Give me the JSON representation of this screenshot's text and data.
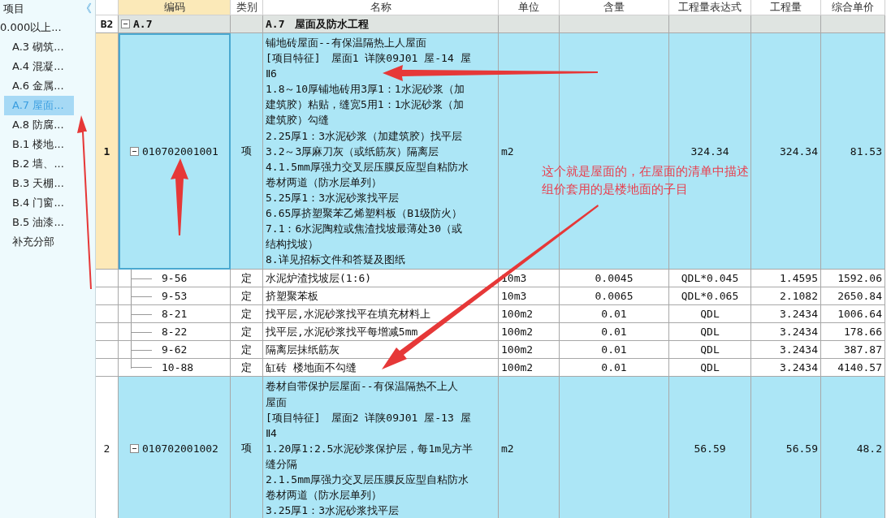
{
  "sidebar": {
    "title": "项目",
    "collapse_icon": "《",
    "items": [
      {
        "label": "0.000以上...",
        "selected": false
      },
      {
        "label": "A.3 砌筑...",
        "selected": false
      },
      {
        "label": "A.4 混凝...",
        "selected": false
      },
      {
        "label": "A.6 金属...",
        "selected": false
      },
      {
        "label": "A.7 屋面...",
        "selected": true
      },
      {
        "label": "A.8 防腐...",
        "selected": false
      },
      {
        "label": "B.1 楼地...",
        "selected": false
      },
      {
        "label": "B.2 墙、...",
        "selected": false
      },
      {
        "label": "B.3 天棚...",
        "selected": false
      },
      {
        "label": "B.4 门窗...",
        "selected": false
      },
      {
        "label": "B.5 油漆...",
        "selected": false
      },
      {
        "label": "补充分部",
        "selected": false
      }
    ]
  },
  "table": {
    "columns": [
      {
        "label": "编码",
        "selected": true
      },
      {
        "label": "类别",
        "selected": false
      },
      {
        "label": "名称",
        "selected": false
      },
      {
        "label": "单位",
        "selected": false
      },
      {
        "label": "含量",
        "selected": false
      },
      {
        "label": "工程量表达式",
        "selected": false
      },
      {
        "label": "工程量",
        "selected": false
      },
      {
        "label": "综合单价",
        "selected": false
      }
    ],
    "rows": [
      {
        "kind": "section",
        "row_header": "B2",
        "code": "A.7",
        "name": "A.7　屋面及防水工程",
        "expanded": true
      },
      {
        "kind": "item",
        "row_header": "1",
        "code": "010702001001",
        "type": "项",
        "name_lines": [
          "铺地砖屋面--有保温隔热上人屋面",
          "[项目特征]　屋面1 详陕09J01 屋-14 屋",
          "Ⅱ6",
          "1.8～10厚铺地砖用3厚1：1水泥砂浆（加",
          "建筑胶）粘贴，缝宽5用1：1水泥砂浆（加",
          "建筑胶）勾缝",
          "2.25厚1：3水泥砂浆（加建筑胶）找平层",
          "3.2～3厚麻刀灰（或纸筋灰）隔离层",
          "4.1.5mm厚强力交叉层压膜反应型自粘防水",
          "卷材两道（防水层单列）",
          "5.25厚1：3水泥砂浆找平层",
          "6.65厚挤塑聚苯乙烯塑料板（B1级防火）",
          "7.1：6水泥陶粒或焦渣找坡最薄处30（或",
          "结构找坡）",
          "8.详见招标文件和答疑及图纸"
        ],
        "unit": "m2",
        "expression": "324.34",
        "quantity": "324.34",
        "unit_price": "81.53",
        "expanded": true,
        "selected": true
      },
      {
        "kind": "sub",
        "code": "9-56",
        "type": "定",
        "name": "水泥炉渣找坡层(1:6)",
        "unit": "10m3",
        "content": "0.0045",
        "expression": "QDL*0.045",
        "quantity": "1.4595",
        "unit_price": "1592.06"
      },
      {
        "kind": "sub",
        "code": "9-53",
        "type": "定",
        "name": "挤塑聚苯板",
        "unit": "10m3",
        "content": "0.0065",
        "expression": "QDL*0.065",
        "quantity": "2.1082",
        "unit_price": "2650.84"
      },
      {
        "kind": "sub",
        "code": "8-21",
        "type": "定",
        "name": "找平层,水泥砂浆找平在填充材料上",
        "unit": "100m2",
        "content": "0.01",
        "expression": "QDL",
        "quantity": "3.2434",
        "unit_price": "1006.64"
      },
      {
        "kind": "sub",
        "code": "8-22",
        "type": "定",
        "name": "找平层,水泥砂浆找平每增减5mm",
        "unit": "100m2",
        "content": "0.01",
        "expression": "QDL",
        "quantity": "3.2434",
        "unit_price": "178.66"
      },
      {
        "kind": "sub",
        "code": "9-62",
        "type": "定",
        "name": "隔离层抹纸筋灰",
        "unit": "100m2",
        "content": "0.01",
        "expression": "QDL",
        "quantity": "3.2434",
        "unit_price": "387.87"
      },
      {
        "kind": "sub",
        "code": "10-88",
        "type": "定",
        "name": "缸砖 楼地面不勾缝",
        "unit": "100m2",
        "content": "0.01",
        "expression": "QDL",
        "quantity": "3.2434",
        "unit_price": "4140.57"
      },
      {
        "kind": "item",
        "row_header": "2",
        "code": "010702001002",
        "type": "项",
        "name_lines": [
          "卷材自带保护层屋面--有保温隔热不上人",
          "屋面",
          "[项目特征]　屋面2 详陕09J01 屋-13 屋",
          "Ⅱ4",
          "1.20厚1:2.5水泥砂浆保护层，每1m见方半",
          "缝分隔",
          "2.1.5mm厚强力交叉层压膜反应型自粘防水",
          "卷材两道（防水层单列）",
          "3.25厚1：3水泥砂浆找平层"
        ],
        "unit": "m2",
        "expression": "56.59",
        "quantity": "56.59",
        "unit_price": "48.2",
        "expanded": true,
        "selected": false
      }
    ]
  },
  "annotation": {
    "lines": [
      "这个就是屋面的，在屋面的清单中描述",
      "组价套用的是楼地面的子目"
    ],
    "color": "#e8404f"
  }
}
